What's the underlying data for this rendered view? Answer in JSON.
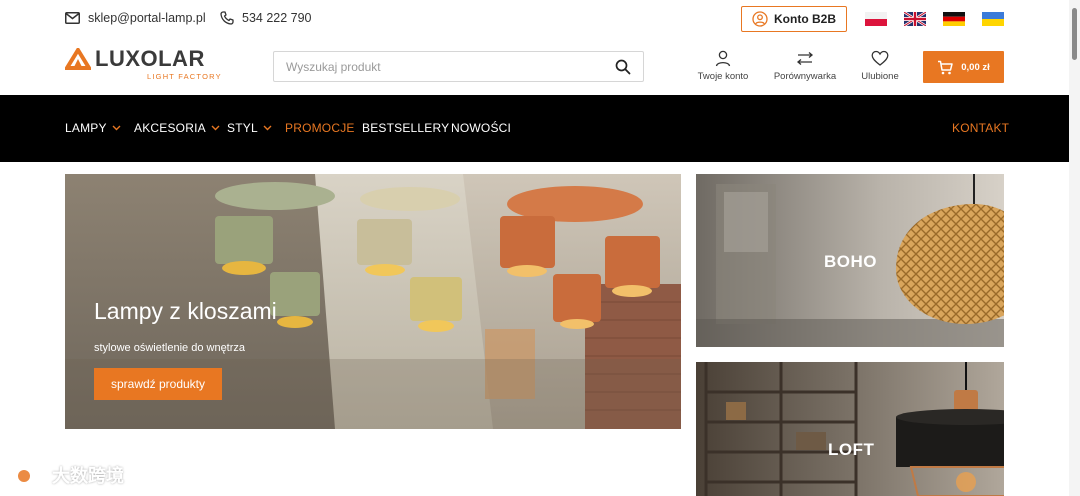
{
  "topbar": {
    "email": "sklep@portal-lamp.pl",
    "phone": "534 222 790",
    "b2b_label": "Konto B2B",
    "languages": [
      "pl-flag",
      "en-flag",
      "de-flag",
      "ua-flag"
    ]
  },
  "header": {
    "logo_text": "LUXOLAR",
    "logo_subtitle": "LIGHT FACTORY",
    "search_placeholder": "Wyszukaj produkt",
    "account_label": "Twoje konto",
    "compare_label": "Porównywarka",
    "favorites_label": "Ulubione",
    "cart_total": "0,00 zł"
  },
  "nav": {
    "items": [
      {
        "label": "LAMPY",
        "dropdown": true
      },
      {
        "label": "AKCESORIA",
        "dropdown": true
      },
      {
        "label": "STYL",
        "dropdown": true
      },
      {
        "label": "PROMOCJE",
        "dropdown": false
      },
      {
        "label": "BESTSELLERY",
        "dropdown": false
      },
      {
        "label": "NOWOŚCI",
        "dropdown": false
      }
    ],
    "contact_label": "KONTAKT"
  },
  "hero": {
    "title": "Lampy z kloszami",
    "subtitle": "stylowe oświetlenie do wnętrza",
    "button_label": "sprawdź produkty"
  },
  "tiles": {
    "boho": "BOHO",
    "loft": "LOFT"
  },
  "watermark": "大数跨境",
  "colors": {
    "accent": "#e87722",
    "nav_bg": "#000000"
  }
}
